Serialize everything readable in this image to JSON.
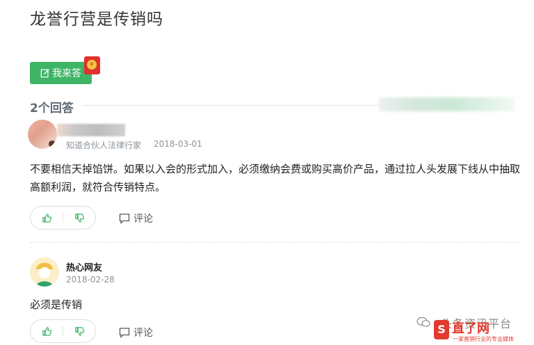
{
  "question": {
    "title": "龙誉行营是传销吗"
  },
  "answer_button": {
    "label": "我来答"
  },
  "answers_header": {
    "count_label": "2个回答"
  },
  "answers": [
    {
      "role": "知道合伙人法律行家",
      "date": "2018-03-01",
      "text": "不要相信天掉馅饼。如果以入会的形式加入，必须缴纳会费或购买高价产品，通过拉人头发展下线从中抽取高额利润，就符合传销特点。",
      "comment_label": "评论"
    },
    {
      "user": "热心网友",
      "date": "2018-02-28",
      "text": "必须是传销",
      "comment_label": "评论"
    }
  ],
  "watermark": {
    "caption": "头条资讯平台",
    "logo_letter": "S",
    "brand": "直了网",
    "tagline": "一家直销行业的专业媒体"
  },
  "colors": {
    "accent_green": "#3eb566",
    "brand_red": "#e23a2e"
  },
  "icons": [
    "edit-icon",
    "red-packet-icon",
    "thumbs-up-icon",
    "thumbs-down-icon",
    "comment-icon",
    "wechat-icon"
  ]
}
